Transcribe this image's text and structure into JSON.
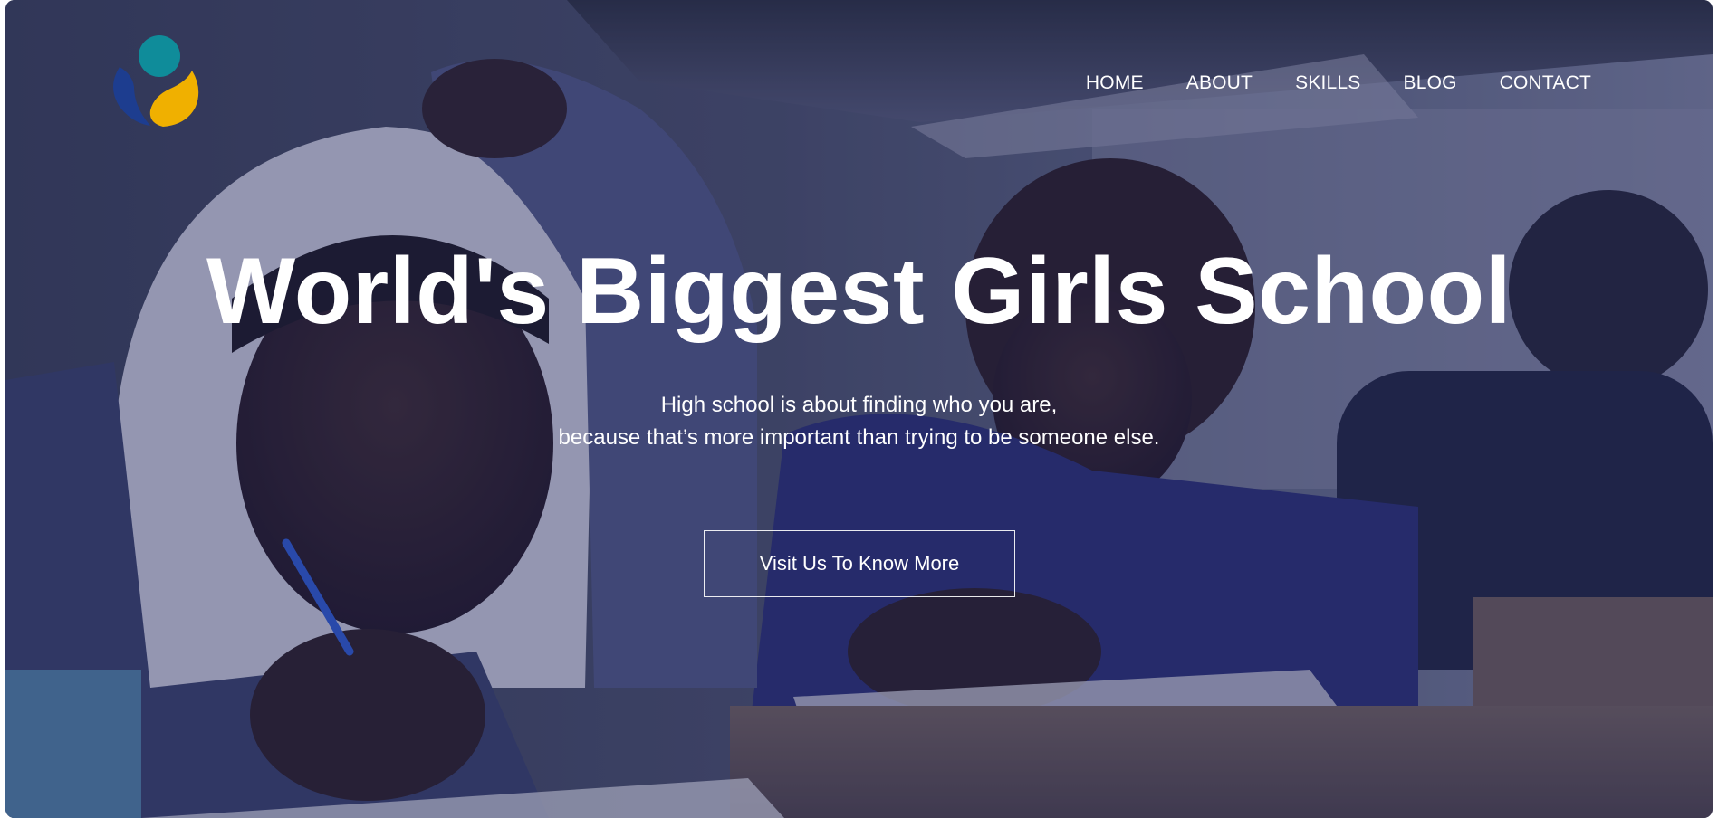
{
  "brand": {
    "logo_icon": "school-logo-icon",
    "colors": {
      "teal": "#0f8c9a",
      "navy": "#1d3d8f",
      "gold": "#f0b000"
    }
  },
  "nav": {
    "items": [
      {
        "label": "HOME"
      },
      {
        "label": "ABOUT"
      },
      {
        "label": "SKILLS"
      },
      {
        "label": "BLOG"
      },
      {
        "label": "CONTACT"
      }
    ]
  },
  "hero": {
    "title": "World's Biggest Girls School",
    "subtitle_line1": "High school is about finding who you are,",
    "subtitle_line2": "because that’s more important than trying to be someone else.",
    "cta_label": "Visit Us To Know More",
    "background_image": "classroom-students-writing-photo"
  }
}
